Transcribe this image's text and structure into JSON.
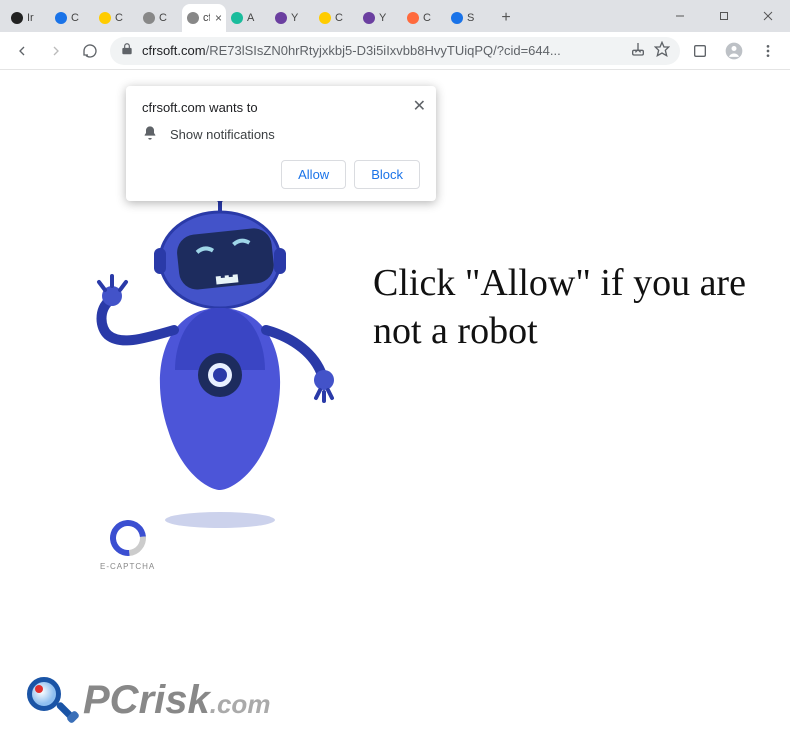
{
  "window": {
    "tabs": [
      {
        "label": "Ir",
        "favicon": "fav-dark"
      },
      {
        "label": "C",
        "favicon": "fav-blue"
      },
      {
        "label": "C",
        "favicon": "fav-yellow"
      },
      {
        "label": "C",
        "favicon": "fav-grey"
      },
      {
        "label": "cf",
        "favicon": "fav-grey",
        "active": true
      },
      {
        "label": "A",
        "favicon": "fav-teal"
      },
      {
        "label": "Y",
        "favicon": "fav-purple"
      },
      {
        "label": "C",
        "favicon": "fav-yellow"
      },
      {
        "label": "Y",
        "favicon": "fav-purple"
      },
      {
        "label": "C",
        "favicon": "fav-orange"
      },
      {
        "label": "S",
        "favicon": "fav-blue"
      }
    ],
    "newtab": "+"
  },
  "addressbar": {
    "domain": "cfrsoft.com",
    "path": "/RE73lSIsZN0hrRtyjxkbj5-D3i5iIxvbb8HvyTUiqPQ/?cid=644..."
  },
  "notification": {
    "title": "cfrsoft.com wants to",
    "permission": "Show notifications",
    "allow": "Allow",
    "block": "Block",
    "close": "✕"
  },
  "page": {
    "headline": "Click \"Allow\" if you are not a robot",
    "captcha_label": "E-CAPTCHA"
  },
  "watermark": {
    "pc": "PC",
    "risk": "risk",
    "dom": ".com"
  }
}
